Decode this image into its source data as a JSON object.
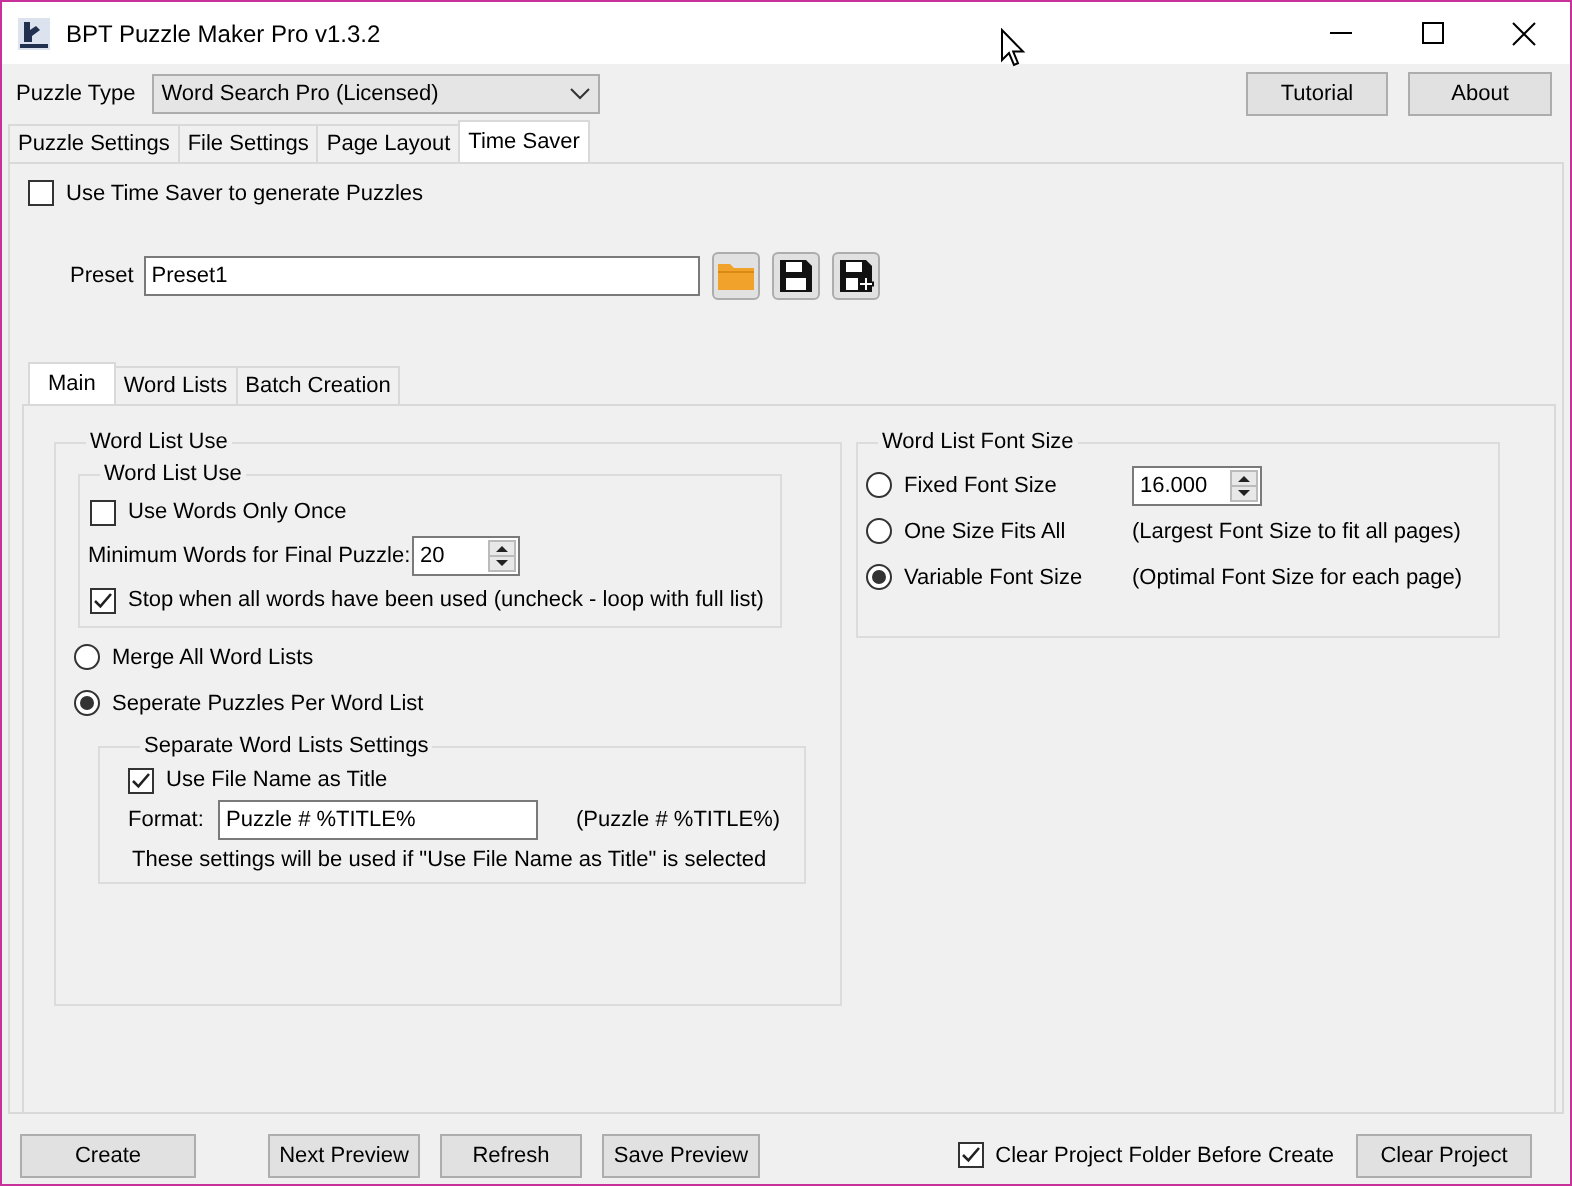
{
  "window": {
    "title": "BPT Puzzle Maker Pro v1.3.2"
  },
  "puzzle_type": {
    "label": "Puzzle Type",
    "value": "Word Search Pro (Licensed)"
  },
  "header_buttons": [
    "Tutorial",
    "About"
  ],
  "tabs": [
    {
      "label": "Puzzle Settings",
      "selected": false
    },
    {
      "label": "File Settings",
      "selected": false
    },
    {
      "label": "Page Layout",
      "selected": false
    },
    {
      "label": "Time Saver",
      "selected": true
    }
  ],
  "use_time_saver": {
    "label": "Use Time Saver to generate Puzzles",
    "checked": false
  },
  "preset": {
    "label": "Preset",
    "value": "Preset1"
  },
  "sub_tabs": [
    {
      "label": "Main",
      "selected": true
    },
    {
      "label": "Word Lists",
      "selected": false
    },
    {
      "label": "Batch Creation",
      "selected": false
    }
  ],
  "word_list_use": {
    "title": "Word List Use",
    "inner": {
      "title": "Word List Use",
      "use_once": {
        "label": "Use Words Only Once",
        "checked": false
      },
      "min_words": {
        "label": "Minimum Words for Final Puzzle:",
        "value": "20"
      },
      "stop_when_used": {
        "label": "Stop when all words have been used (uncheck - loop with full list)",
        "checked": true
      }
    },
    "modes": [
      {
        "label": "Merge All Word Lists",
        "selected": false
      },
      {
        "label": "Seperate Puzzles Per Word List",
        "selected": true
      }
    ],
    "separate": {
      "title": "Separate Word Lists Settings",
      "use_file_name": {
        "label": "Use File Name as Title",
        "checked": true
      },
      "format": {
        "label": "Format:",
        "value": "Puzzle # %TITLE%",
        "preview": "(Puzzle # %TITLE%)"
      },
      "note": "These settings will be used if \"Use File Name as Title\" is selected"
    }
  },
  "font_size": {
    "title": "Word List Font Size",
    "options": [
      {
        "label": "Fixed Font Size",
        "selected": false,
        "kind": "spinner",
        "value": "16.000"
      },
      {
        "label": "One Size Fits All",
        "selected": false,
        "kind": "note",
        "note": "(Largest Font Size to fit all pages)"
      },
      {
        "label": "Variable Font Size",
        "selected": true,
        "kind": "note",
        "note": "(Optimal Font Size for each page)"
      }
    ]
  },
  "footer": {
    "buttons": [
      "Create",
      "Next Preview",
      "Refresh",
      "Save Preview"
    ],
    "clear_folder": {
      "label": "Clear Project Folder Before Create",
      "checked": true
    },
    "clear_button": "Clear Project"
  }
}
